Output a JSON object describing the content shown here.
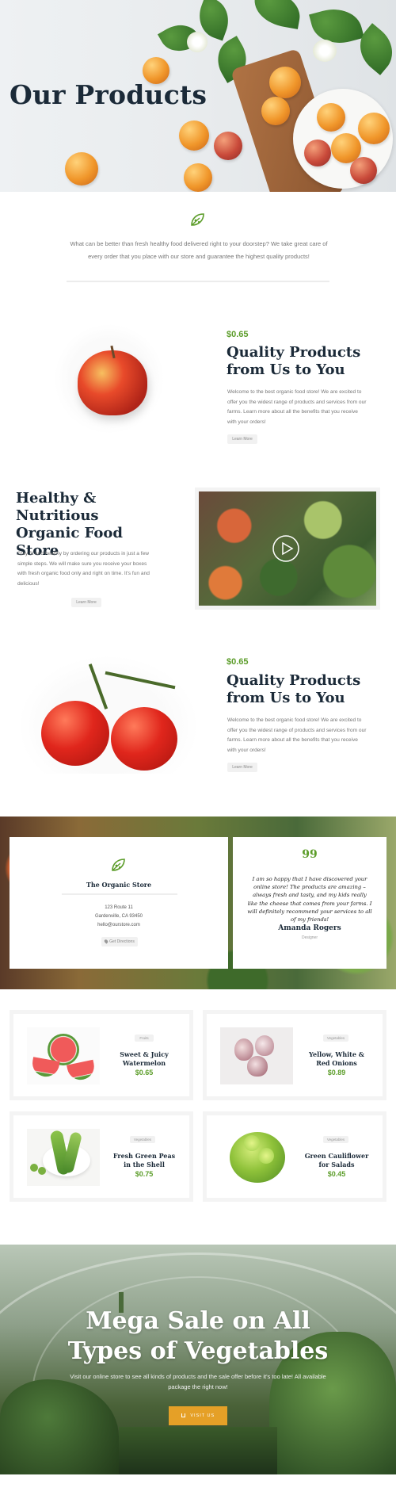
{
  "hero": {
    "title": "Our Products"
  },
  "intro": {
    "text": "What can be better than fresh healthy food delivered right to your doorstep? We take great care of every order that you place with our store and guarantee the highest quality products!"
  },
  "features": [
    {
      "price": "$0.65",
      "title": "Quality Products from Us to You",
      "text": "Welcome to the best organic food store! We are excited to offer you the widest range of products and services from our farms. Learn more about all the benefits that you receive with your orders!",
      "button": "Learn More"
    },
    {
      "title": "Healthy & Nutritious Organic Food Store",
      "text": "Stay fit and healthy by ordering our products in just a few simple steps. We will make sure you receive your boxes with fresh organic food only and right on time. It's fun and delicious!",
      "button": "Learn More"
    },
    {
      "price": "$0.65",
      "title": "Quality Products from Us to You",
      "text": "Welcome to the best organic food store! We are excited to offer you the widest range of products and services from our farms. Learn more about all the benefits that you receive with your orders!",
      "button": "Learn More"
    }
  ],
  "contact": {
    "store_name": "The Organic Store",
    "address_line1": "123 Route 11",
    "address_line2": "Gardenville, CA 93450",
    "email": "hello@ourstore.com",
    "button": "Get Directions"
  },
  "testimonial": {
    "quote_mark": "99",
    "quote": "I am so happy that I have discovered your online store! The products are amazing – always fresh and tasty, and my kids really like the cheese that comes from your farms. I will definitely recommend your services to all of my friends!",
    "name": "Amanda Rogers",
    "role": "Designer"
  },
  "products": [
    {
      "tag": "Fruits",
      "name": "Sweet & Juicy Watermelon",
      "price": "$0.65"
    },
    {
      "tag": "Vegetables",
      "name": "Yellow, White & Red Onions",
      "price": "$0.89"
    },
    {
      "tag": "Vegetables",
      "name": "Fresh Green Peas in the Shell",
      "price": "$0.75"
    },
    {
      "tag": "Vegetables",
      "name": "Green Cauliflower for Salads",
      "price": "$0.45"
    }
  ],
  "sale": {
    "title_line1": "Mega Sale on All",
    "title_line2": "Types of Vegetables",
    "text": "Visit our online store to see all kinds of products and the sale offer before it's too late! All available package the right now!",
    "button": "VISIT US"
  },
  "colors": {
    "accent_green": "#5c9d2a",
    "dark_heading": "#1b2a38",
    "sale_button": "#e5a027"
  },
  "icons": [
    "leaf-logo-icon",
    "play-icon",
    "map-pin-icon",
    "quote-icon",
    "cart-icon"
  ]
}
